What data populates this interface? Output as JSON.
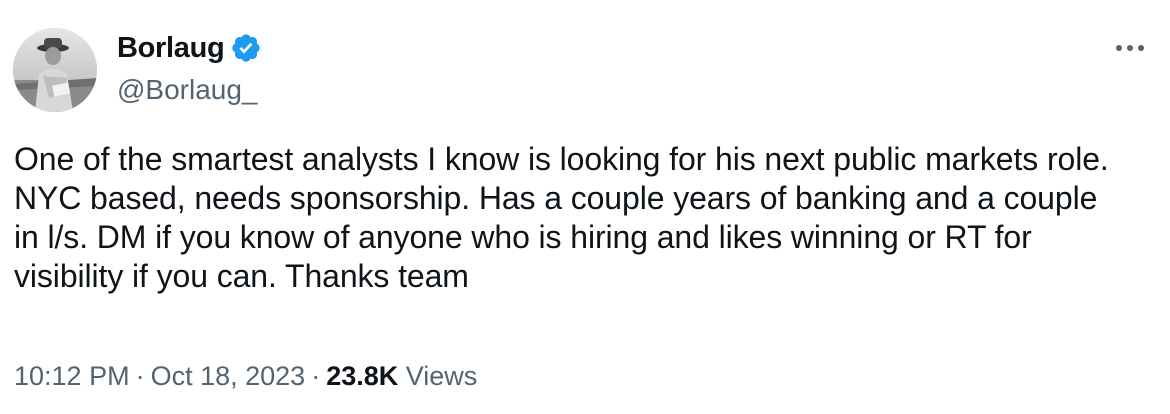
{
  "author": {
    "display_name": "Borlaug",
    "handle": "@Borlaug_",
    "verified": true
  },
  "tweet": {
    "text": "One of the smartest analysts I know is looking for his next public markets role. NYC based, needs sponsorship. Has a couple years of banking and a couple in l/s. DM if you know of anyone who is hiring and likes winning or RT for visibility if you can. Thanks team",
    "time": "10:12 PM",
    "date": "Oct 18, 2023",
    "views_count": "23.8K",
    "views_label": "Views",
    "separator": "·"
  },
  "icons": {
    "verified": "verified-badge-icon",
    "more": "more-options-icon"
  },
  "colors": {
    "text": "#0f1419",
    "secondary": "#536471",
    "verified_blue": "#1d9bf0",
    "background": "#ffffff"
  }
}
